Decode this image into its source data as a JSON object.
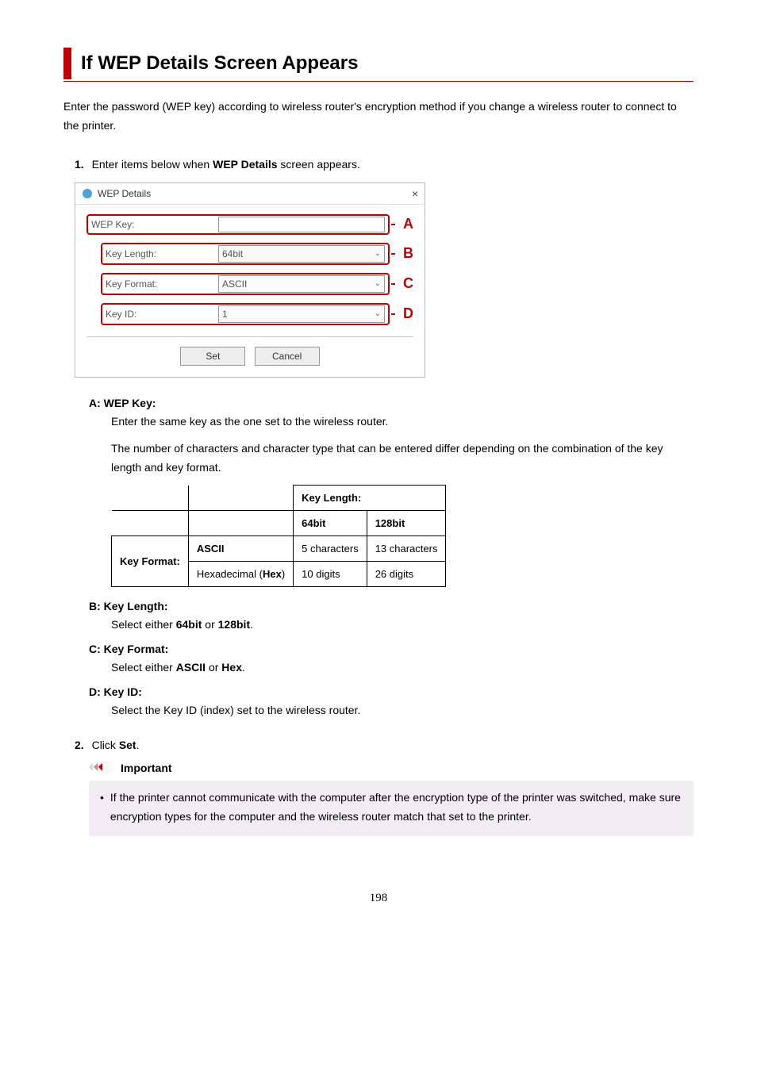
{
  "page": {
    "title": "If WEP Details Screen Appears",
    "intro": "Enter the password (WEP key) according to wireless router's encryption method if you change a wireless router to connect to the printer.",
    "page_number": "198"
  },
  "step1": {
    "number": "1.",
    "text_prefix": "Enter items below when ",
    "text_bold": "WEP Details",
    "text_suffix": " screen appears."
  },
  "dialog": {
    "title": "WEP Details",
    "close": "×",
    "wep_key_label": "WEP Key:",
    "key_length_label": "Key Length:",
    "key_length_value": "64bit",
    "key_format_label": "Key Format:",
    "key_format_value": "ASCII",
    "key_id_label": "Key ID:",
    "key_id_value": "1",
    "set_btn": "Set",
    "cancel_btn": "Cancel",
    "letter_a": "A",
    "letter_b": "B",
    "letter_c": "C",
    "letter_d": "D"
  },
  "definitions": {
    "a_label": "A: WEP Key:",
    "a_body1": "Enter the same key as the one set to the wireless router.",
    "a_body2": "The number of characters and character type that can be entered differ depending on the combination of the key length and key format.",
    "b_label": "B: Key Length:",
    "b_body_pre": "Select either ",
    "b_body_b1": "64bit",
    "b_body_mid": " or ",
    "b_body_b2": "128bit",
    "b_body_end": ".",
    "c_label": "C: Key Format:",
    "c_body_pre": "Select either ",
    "c_body_b1": "ASCII",
    "c_body_mid": " or ",
    "c_body_b2": "Hex",
    "c_body_end": ".",
    "d_label": "D: Key ID:",
    "d_body": "Select the Key ID (index) set to the wireless router."
  },
  "table": {
    "head_keylength": "Key Length:",
    "col_64": "64bit",
    "col_128": "128bit",
    "row_format_label": "Key Format:",
    "row_ascii": "ASCII",
    "ascii_64": "5 characters",
    "ascii_128": "13 characters",
    "row_hex_pre": "Hexadecimal (",
    "row_hex_bold": "Hex",
    "row_hex_post": ")",
    "hex_64": "10 digits",
    "hex_128": "26 digits"
  },
  "chart_data": {
    "type": "table",
    "title": "WEP key character requirements by key length and format",
    "columns": [
      "Key Format",
      "64bit",
      "128bit"
    ],
    "rows": [
      {
        "Key Format": "ASCII",
        "64bit": "5 characters",
        "128bit": "13 characters"
      },
      {
        "Key Format": "Hexadecimal (Hex)",
        "64bit": "10 digits",
        "128bit": "26 digits"
      }
    ]
  },
  "step2": {
    "number": "2.",
    "pre": "Click ",
    "bold": "Set",
    "post": "."
  },
  "important": {
    "heading": "Important",
    "bullet": "If the printer cannot communicate with the computer after the encryption type of the printer was switched, make sure encryption types for the computer and the wireless router match that set to the printer."
  }
}
